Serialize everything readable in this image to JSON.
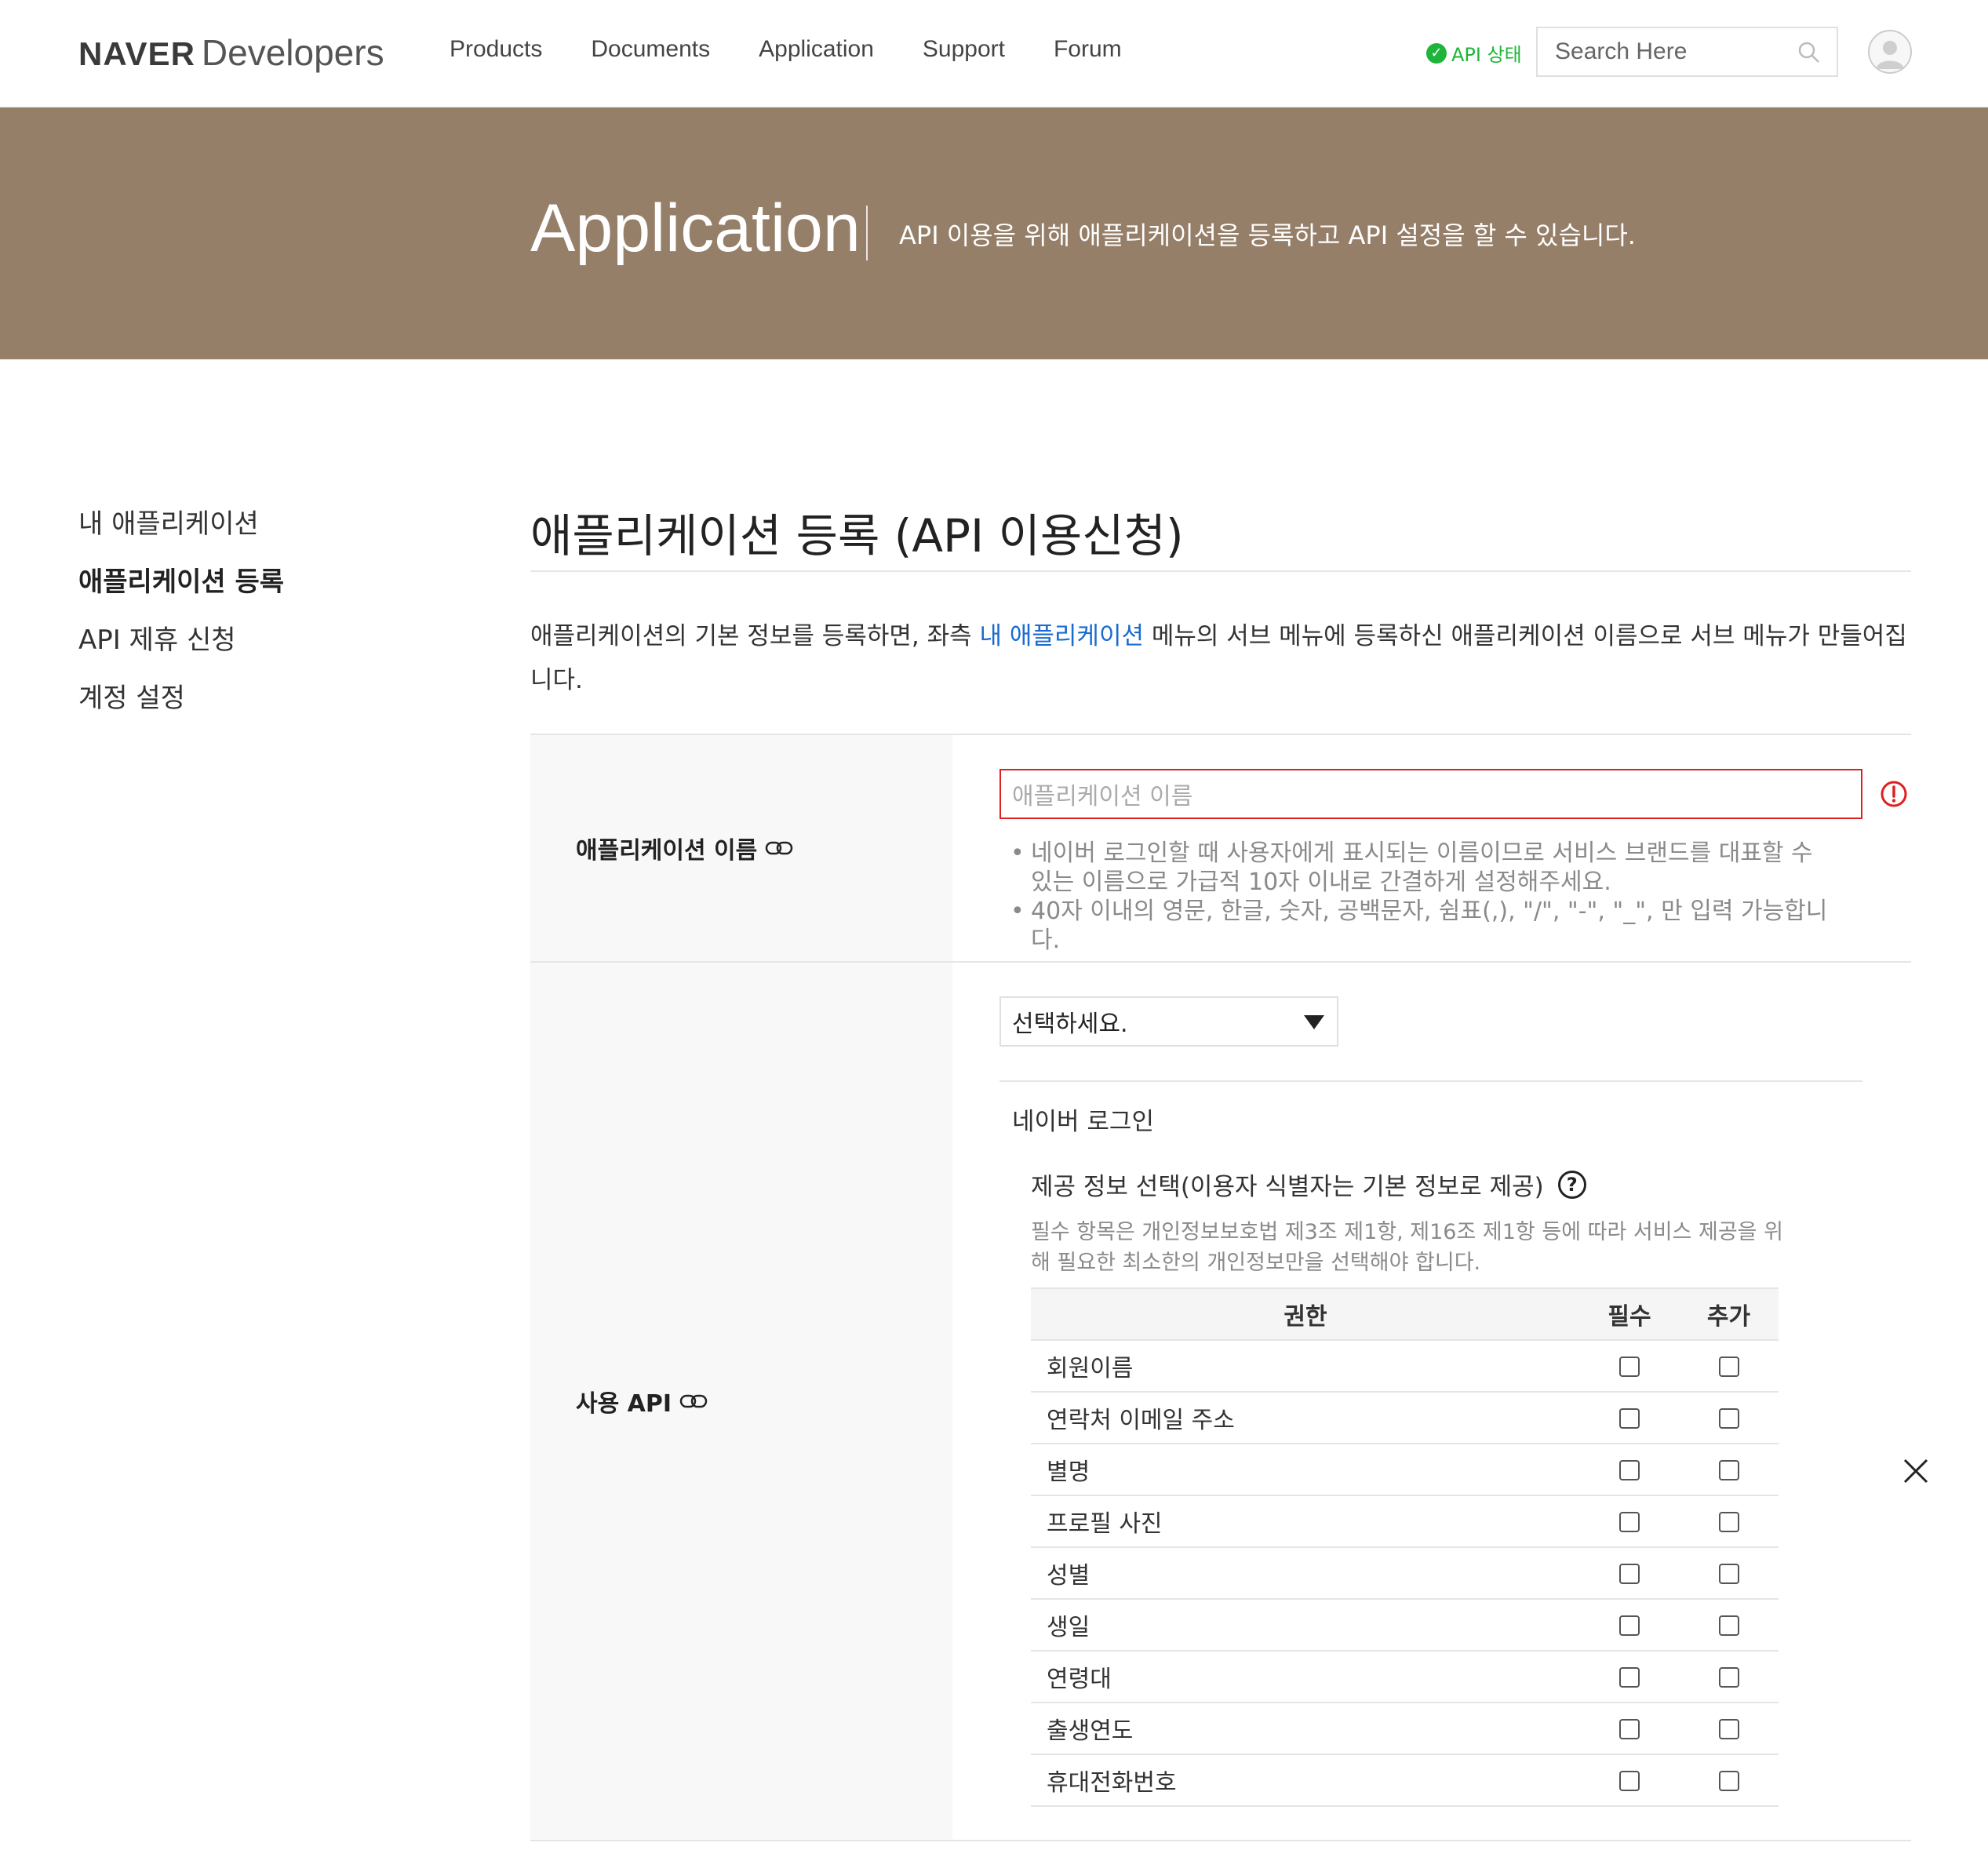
{
  "header": {
    "logo_brand": "NAVER",
    "logo_sub": "Developers",
    "nav": [
      "Products",
      "Documents",
      "Application",
      "Support",
      "Forum"
    ],
    "api_status": "API 상태",
    "search_placeholder": "Search Here"
  },
  "banner": {
    "title": "Application",
    "desc": "API 이용을 위해 애플리케이션을 등록하고 API 설정을 할 수 있습니다."
  },
  "sidebar": {
    "items": [
      {
        "label": "내 애플리케이션"
      },
      {
        "label": "애플리케이션 등록",
        "active": true
      },
      {
        "label": "API 제휴 신청"
      },
      {
        "label": "계정 설정"
      }
    ]
  },
  "main": {
    "title": "애플리케이션 등록 (API 이용신청)",
    "intro_before": "애플리케이션의 기본 정보를 등록하면, 좌측 ",
    "intro_link": "내 애플리케이션",
    "intro_after": " 메뉴의 서브 메뉴에 등록하신 애플리케이션 이름으로 서브 메뉴가 만들어집니다."
  },
  "form": {
    "app_name": {
      "label": "애플리케이션 이름",
      "placeholder": "애플리케이션 이름",
      "help": [
        "네이버 로그인할 때 사용자에게 표시되는 이름이므로 서비스 브랜드를 대표할 수 있는 이름으로 가급적 10자 이내로 간결하게 설정해주세요.",
        "40자 이내의 영문, 한글, 숫자, 공백문자, 쉼표(,), \"/\", \"-\", \"_\", 만 입력 가능합니다."
      ]
    },
    "api": {
      "label": "사용 API",
      "select_value": "선택하세요.",
      "selected_api": "네이버 로그인",
      "provide_title": "제공 정보 선택(이용자 식별자는 기본 정보로 제공)",
      "provide_note": "필수 항목은 개인정보보호법 제3조 제1항, 제16조 제1항 등에 따라 서비스 제공을 위해 필요한 최소한의 개인정보만을 선택해야 합니다.",
      "columns": [
        "권한",
        "필수",
        "추가"
      ],
      "permissions": [
        "회원이름",
        "연락처 이메일 주소",
        "별명",
        "프로필 사진",
        "성별",
        "생일",
        "연령대",
        "출생연도",
        "휴대전화번호"
      ]
    }
  },
  "colors": {
    "banner": "#967f69",
    "link": "#1a6bd1",
    "status_ok": "#1eb53a",
    "error": "#e02020"
  }
}
